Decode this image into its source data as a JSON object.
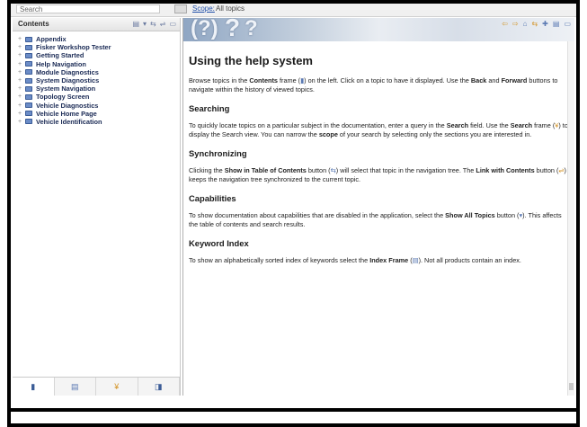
{
  "search": {
    "value": "Search",
    "scope_link": "Scope:",
    "scope_value": "All topics"
  },
  "sidebar": {
    "title": "Contents",
    "toolbar_icons": [
      "print-icon",
      "filter-icon",
      "show-in-toc-icon",
      "link-icon",
      "collapse-icon"
    ],
    "items": [
      {
        "label": "Appendix"
      },
      {
        "label": "Fisker Workshop Tester"
      },
      {
        "label": "Getting Started"
      },
      {
        "label": "Help Navigation"
      },
      {
        "label": "Module Diagnostics"
      },
      {
        "label": "System Diagnostics"
      },
      {
        "label": "System Navigation"
      },
      {
        "label": "Topology Screen"
      },
      {
        "label": "Vehicle Diagnostics"
      },
      {
        "label": "Vehicle Home Page"
      },
      {
        "label": "Vehicle Identification"
      }
    ],
    "tabs": [
      "contents-tab-icon",
      "index-tab-icon",
      "search-tab-icon",
      "bookmarks-tab-icon"
    ]
  },
  "content": {
    "title": "Using the help system",
    "intro_parts": [
      "Browse topics in the ",
      "Contents",
      " frame (",
      ") on the left. Click on a topic to have it displayed. Use the ",
      "Back",
      " and ",
      "Forward",
      " buttons to navigate within the history of viewed topics."
    ],
    "sections": [
      {
        "heading": "Searching",
        "parts": [
          "To quickly locate topics on a particular subject in the documentation, enter a query in the ",
          "Search",
          " field. Use the ",
          "Search",
          " frame (",
          ") to display the Search view. You can narrow the ",
          "scope",
          " of your search by selecting only the sections you are interested in."
        ]
      },
      {
        "heading": "Synchronizing",
        "parts": [
          "Clicking the ",
          "Show in Table of Contents",
          " button (",
          ") will select that topic in the navigation tree. The ",
          "Link with Contents",
          " button (",
          ") keeps the navigation tree synchronized to the current topic."
        ]
      },
      {
        "heading": "Capabilities",
        "parts": [
          "To show documentation about capabilities that are disabled in the application, select the ",
          "Show All Topics",
          " button (",
          "). This affects the table of contents and search results."
        ]
      },
      {
        "heading": "Keyword Index",
        "parts": [
          "To show an alphabetically sorted index of keywords select the ",
          "Index Frame",
          " (",
          "). Not all products contain an index."
        ]
      }
    ]
  },
  "colors": {
    "link": "#1f4ea8",
    "tree_text": "#1a2a55",
    "accent_icon": "#d4952a"
  }
}
